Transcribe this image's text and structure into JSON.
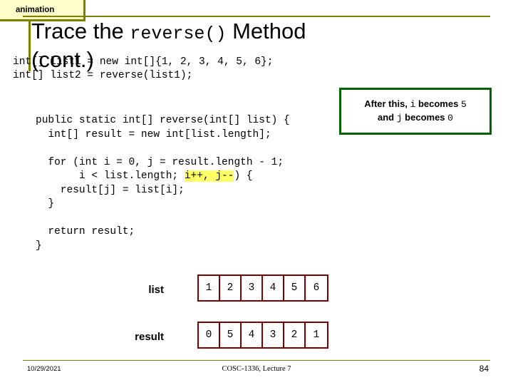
{
  "tab": {
    "label": "animation"
  },
  "title": {
    "line1_pre": "Trace the ",
    "line1_mono": "reverse()",
    "line1_post": " Method",
    "line2": "(cont.)"
  },
  "declarations": "int[] list1 = new int[]{1, 2, 3, 4, 5, 6};\nint[] list2 = reverse(list1);",
  "callout": {
    "text1": "After this, ",
    "var1": "i",
    "text2": " becomes ",
    "val1": "5",
    "text3": "and ",
    "var2": "j",
    "text4": " becomes ",
    "val2": "0"
  },
  "method_code": {
    "l1": "public static int[] reverse(int[] list) {",
    "l2": "  int[] result = new int[list.length];",
    "l3": "",
    "l4": "  for (int i = 0, j = result.length - 1;",
    "l5": "       i < list.length; ",
    "l5_hl": "i++, j--",
    "l5_post": ") {",
    "l6": "    result[j] = list[i];",
    "l7": "  }",
    "l8": "",
    "l9": "  return result;",
    "l10": "}"
  },
  "arrays": {
    "list_label": "list",
    "list_values": [
      "1",
      "2",
      "3",
      "4",
      "5",
      "6"
    ],
    "result_label": "result",
    "result_values": [
      "0",
      "5",
      "4",
      "3",
      "2",
      "1"
    ]
  },
  "footer": {
    "date": "10/29/2021",
    "center": "COSC-1336, Lecture 7",
    "page": "84"
  },
  "colors": {
    "rule": "#808000",
    "tab_bg": "#ffffcc",
    "callout_border": "#006600",
    "array_border": "#800000",
    "highlight": "#ffff66"
  }
}
